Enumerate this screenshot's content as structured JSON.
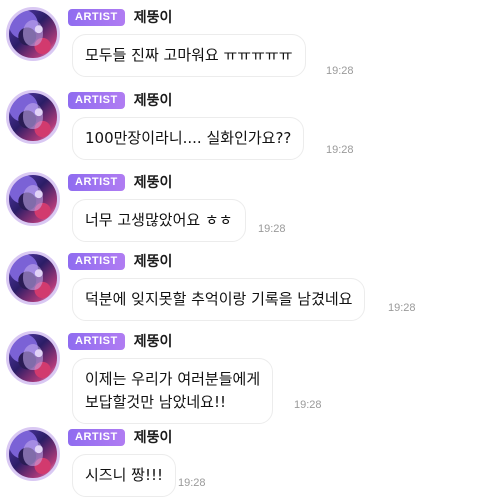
{
  "messages": [
    {
      "badge": "ARTIST",
      "sender": "제뚱이",
      "lines": [
        "모두들 진짜 고마워요 ㅠㅠㅠㅠㅠ"
      ],
      "time": "19:28"
    },
    {
      "badge": "ARTIST",
      "sender": "제뚱이",
      "lines": [
        "100만장이라니.... 실화인가요??"
      ],
      "time": "19:28"
    },
    {
      "badge": "ARTIST",
      "sender": "제뚱이",
      "lines": [
        "너무 고생많았어요 ㅎㅎ"
      ],
      "time": "19:28"
    },
    {
      "badge": "ARTIST",
      "sender": "제뚱이",
      "lines": [
        "덕분에 잊지못할 추억이랑 기록을 남겼네요"
      ],
      "time": "19:28"
    },
    {
      "badge": "ARTIST",
      "sender": "제뚱이",
      "lines": [
        "이제는 우리가 여러분들에게",
        "보답할것만 남았네요!!"
      ],
      "time": "19:28"
    },
    {
      "badge": "ARTIST",
      "sender": "제뚱이",
      "lines": [
        "시즈니 짱!!!"
      ],
      "time": "19:28"
    }
  ],
  "colors": {
    "badge_start": "#8f6cf0",
    "badge_end": "#b07cf2",
    "timestamp": "#9a9a9a",
    "avatar_border": "#d9c8f3"
  },
  "icons": {
    "avatar": "profile-photo"
  }
}
